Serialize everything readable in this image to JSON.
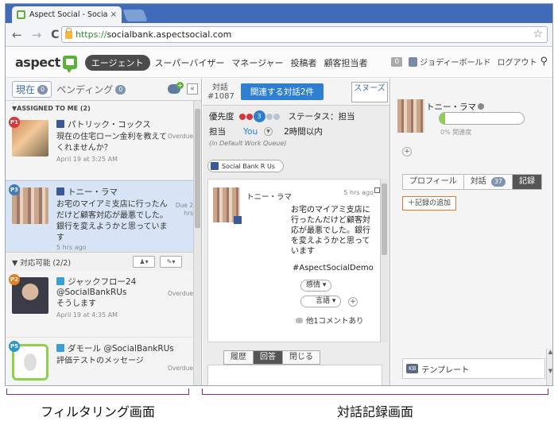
{
  "browser": {
    "tab_title": "Aspect Social - Social Ban",
    "tab_close": "×",
    "url_scheme": "https://",
    "url_host": "socialbank.aspectsocial.com",
    "back": "←",
    "forward": "→",
    "reload": "C",
    "star": "☆"
  },
  "app": {
    "logo": "aspect",
    "nav": [
      "エージェント",
      "スーパーバイザー",
      "マネージャー",
      "投稿者",
      "顧客担当者"
    ],
    "count": "0",
    "user": "ジョディーボールド",
    "logout": "ログアウト"
  },
  "left": {
    "tab_current": "現在",
    "tab_current_count": "0",
    "tab_pending": "ペンディング",
    "tab_pending_count": "0",
    "collapse": "«",
    "assigned_header": "▼ASSIGNED TO ME (2)",
    "items": [
      {
        "badge": "P1",
        "name": "パトリック・コックス",
        "message": "現在の住宅ローン金利を教えてくれませんか？",
        "date": "April 19 at 3:25 AM",
        "status": "Overdue"
      },
      {
        "badge": "P3",
        "name": "トニー・ラマ",
        "message": "お宅のマイアミ支店に行ったんだけど顧客対応が最悪でした。銀行を変えようかと思っています",
        "date": "5 hrs ago",
        "status": "Due 2 hrs"
      }
    ],
    "available_header": "▼ 対応可能 (2/2)",
    "items2": [
      {
        "badge": "P2",
        "name": "ジャックフロー24 @SocialBankRUs",
        "message": "そうします",
        "date": "April 19 at 4:35 AM",
        "status": "Overdue"
      },
      {
        "badge": "P5",
        "name": "ダモール @SocialBankRUs",
        "message": "評価テストのメッセージ",
        "date": "",
        "status": "Overdue"
      }
    ]
  },
  "middle": {
    "conv_label": "対話",
    "conv_id": "#1087",
    "related_button": "関連する対話2件",
    "swerve": "スヌーズ",
    "priority_label": "優先度",
    "priority_value": "3",
    "status_label": "ステータス：担当",
    "owner_label": "担当",
    "owner_value": "You",
    "sla": "2時間以内",
    "queue": "(in Default Work Queue)",
    "channel_button": "Social Bank R Us",
    "post_author": "トニー・ラマ",
    "post_time": "5 hrs ago",
    "post_message": "お宅のマイアミ支店に行ったんだけど顧客対応が最悪でした。銀行を変えようかと思っています",
    "hashtag": "#AspectSocialDemo",
    "chip_emotion": "感情",
    "chip_language": "言語",
    "comment": "他1コメントあり",
    "tabs": [
      "履歴",
      "回答",
      "閉じる"
    ]
  },
  "right": {
    "customer_name": "トニー・ラマ",
    "loyalty_label": "0% 関連度",
    "loyalty_value": 0.07,
    "tabs": [
      "プロフィール",
      "対話",
      "記録"
    ],
    "conv_count": "37",
    "add_record": "＋記録の追加",
    "kb_icon": "KB",
    "kb_label": "テンプレート"
  },
  "captions": {
    "left": "フィルタリング画面",
    "right": "対話記録画面"
  },
  "colors": {
    "brand_green": "#5fb03a",
    "accent_blue": "#2e7fd1",
    "chrome_blue": "#3f6bb8",
    "bracket_purple": "#7b2d8e"
  }
}
